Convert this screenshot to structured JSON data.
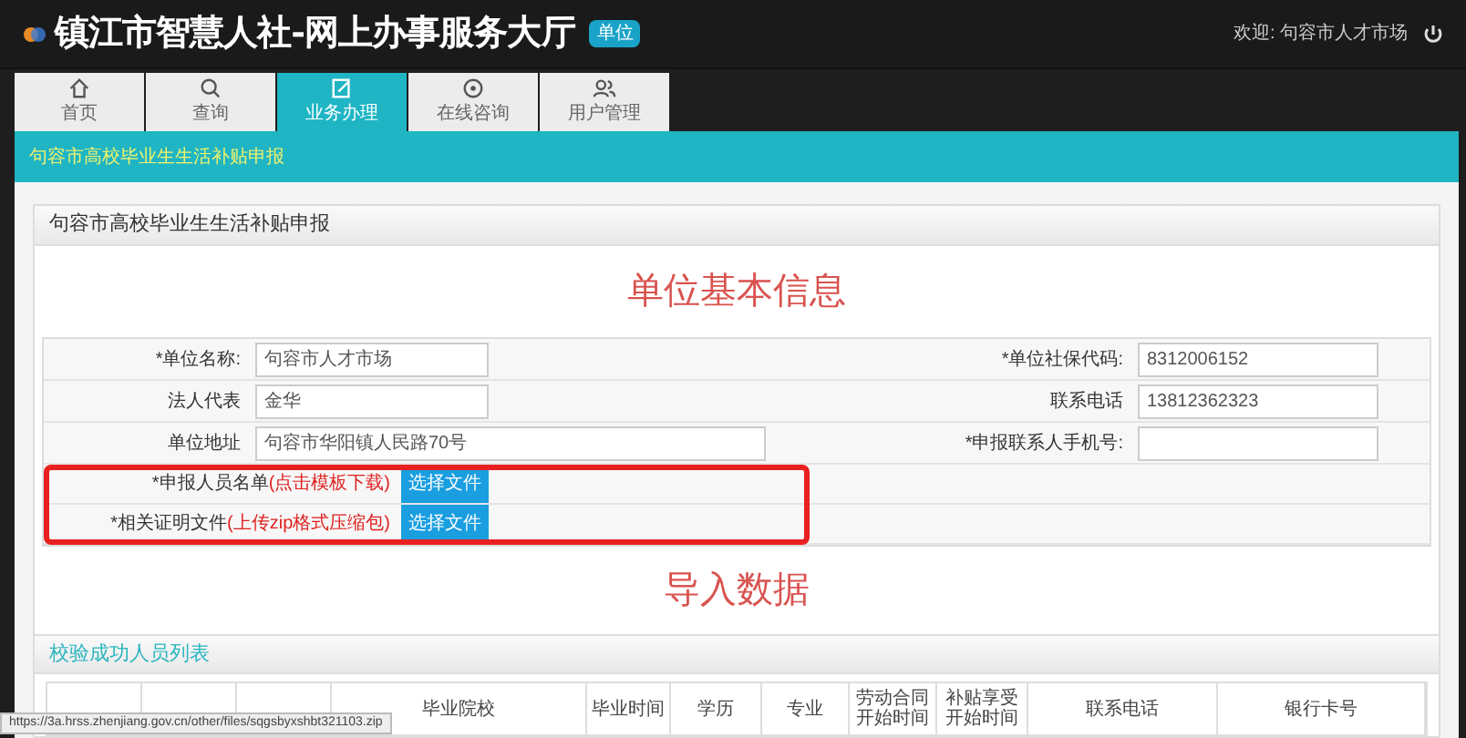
{
  "header": {
    "title": "镇江市智慧人社-网上办事服务大厅",
    "badge": "单位",
    "welcome": "欢迎: 句容市人才市场"
  },
  "tabs": [
    {
      "label": "首页",
      "selected": false
    },
    {
      "label": "查询",
      "selected": false
    },
    {
      "label": "业务办理",
      "selected": true
    },
    {
      "label": "在线咨询",
      "selected": false
    },
    {
      "label": "用户管理",
      "selected": false
    }
  ],
  "breadcrumb": "句容市高校毕业生生活补贴申报",
  "panel_title": "句容市高校毕业生生活补贴申报",
  "section_1": "单位基本信息",
  "fields_left": [
    {
      "label": "*单位名称:",
      "value": "句容市人才市场"
    },
    {
      "label": "法人代表",
      "value": "金华"
    },
    {
      "label": "单位地址",
      "value": "句容市华阳镇人民路70号"
    }
  ],
  "fields_right": [
    {
      "label": "*单位社保代码:",
      "value": "8312006152"
    },
    {
      "label": "联系电话",
      "value": "13812362323"
    },
    {
      "label": "*申报联系人手机号:"
    }
  ],
  "file_rows": [
    {
      "label": "*申报人员名单",
      "note": "(点击模板下载)",
      "button": "选择文件"
    },
    {
      "label": "*相关证明文件",
      "note": "(上传zip格式压缩包)",
      "button": "选择文件"
    }
  ],
  "section_2": "导入数据",
  "list_title": "校验成功人员列表",
  "table": {
    "columns": [
      "毕业院校",
      "毕业时间",
      "学历",
      "专业",
      "劳动合同开始时间",
      "补贴享受开始时间",
      "联系电话",
      "银行卡号"
    ]
  },
  "status_bar": "https://3a.hrss.zhenjiang.gov.cn/other/files/sqgsbyxshbt321103.zip"
}
